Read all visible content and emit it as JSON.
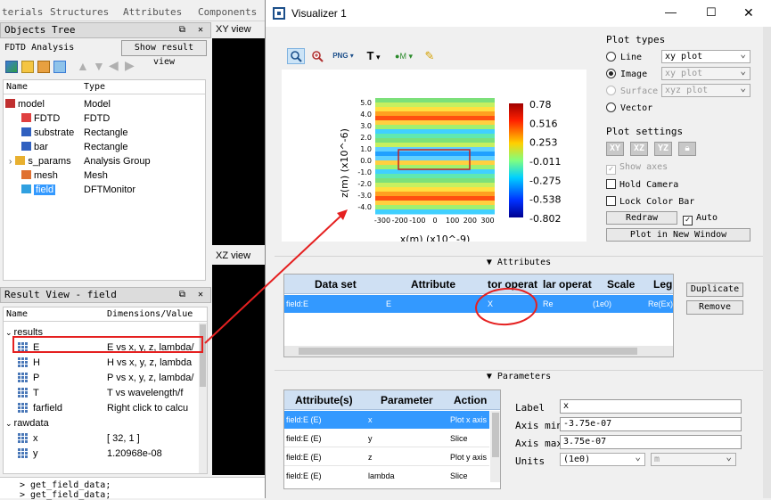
{
  "top_menu": [
    "terials",
    "Structures",
    "Attributes",
    "Components"
  ],
  "objects_tree": {
    "title": "Objects Tree",
    "window_controls": "⧉ ✕",
    "analysis_label": "FDTD Analysis",
    "show_result_button": "Show result view",
    "columns": [
      "Name",
      "Type"
    ],
    "rows": [
      {
        "name": "model",
        "type": "Model",
        "icon": "model-icon"
      },
      {
        "name": "FDTD",
        "type": "FDTD",
        "icon": "fdtd-icon"
      },
      {
        "name": "substrate",
        "type": "Rectangle",
        "icon": "rectangle-icon"
      },
      {
        "name": "bar",
        "type": "Rectangle",
        "icon": "rectangle-icon"
      },
      {
        "name": "s_params",
        "type": "Analysis Group",
        "icon": "folder-icon"
      },
      {
        "name": "mesh",
        "type": "Mesh",
        "icon": "mesh-icon"
      },
      {
        "name": "field",
        "type": "DFTMonitor",
        "icon": "monitor-icon"
      }
    ]
  },
  "view_labels": {
    "xy": "XY view",
    "xz": "XZ view"
  },
  "result_view": {
    "title": "Result View - field",
    "window_controls": "⧉ ✕",
    "columns": [
      "Name",
      "Dimensions/Value"
    ],
    "groups": [
      {
        "label": "results",
        "items": [
          {
            "name": "E",
            "value": "E vs x, y, z, lambda/"
          },
          {
            "name": "H",
            "value": "H vs x, y, z, lambda"
          },
          {
            "name": "P",
            "value": "P vs x, y, z, lambda/"
          },
          {
            "name": "T",
            "value": "T vs wavelength/f"
          },
          {
            "name": "farfield",
            "value": "Right click to calcu"
          }
        ]
      },
      {
        "label": "rawdata",
        "items": [
          {
            "name": "x",
            "value": "[ 32, 1 ]"
          },
          {
            "name": "y",
            "value": "1.20968e-08"
          }
        ]
      }
    ]
  },
  "console": [
    "> get_field_data;",
    "> get_field_data;"
  ],
  "visualizer": {
    "title": "Visualizer 1",
    "window_buttons": [
      "—",
      "☐",
      "✕"
    ],
    "toolbar": [
      "zoom-icon",
      "zoom-in-icon",
      "png-export-icon",
      "text-icon",
      "marker-icon",
      "pen-icon"
    ],
    "toolbar_labels": {
      "png": "PNG",
      "text": "T",
      "marker": "M"
    },
    "plot": {
      "ylabel": "z(m) (x10^-6)",
      "xlabel": "x(m) (x10^-9)",
      "yticks": [
        "5.0",
        "4.0",
        "3.0",
        "2.0",
        "1.0",
        "0.0",
        "-1.0",
        "-2.0",
        "-3.0",
        "-4.0"
      ],
      "xticks": [
        "-300",
        "-200",
        "-100",
        "0",
        "100",
        "200",
        "300"
      ],
      "colorbar_ticks": [
        "0.78",
        "0.516",
        "0.253",
        "-0.011",
        "-0.275",
        "-0.538",
        "-0.802"
      ]
    },
    "plot_types": {
      "title": "Plot types",
      "options": [
        {
          "label": "Line",
          "select": "xy plot",
          "on": false,
          "disabled": false
        },
        {
          "label": "Image",
          "select": "xy plot",
          "on": true,
          "disabled": false
        },
        {
          "label": "Surface",
          "select": "xyz plot",
          "on": false,
          "disabled": true
        },
        {
          "label": "Vector",
          "select": "",
          "on": false,
          "disabled": false
        }
      ]
    },
    "plot_settings": {
      "title": "Plot settings",
      "view_buttons": [
        "XY",
        "XZ",
        "YZ"
      ],
      "show_axes": "Show axes",
      "hold_camera": "Hold Camera",
      "lock_color_bar": "Lock Color Bar",
      "redraw": "Redraw",
      "auto": "Auto",
      "new_window": "Plot in New Window"
    },
    "attributes": {
      "section": "Attributes",
      "columns": [
        "Data set",
        "Attribute",
        "tor operat",
        "lar operat",
        "Scale",
        "Leg"
      ],
      "row": [
        "field:E",
        "E",
        "X",
        "Re",
        "(1e0)",
        "Re(Ex)"
      ],
      "duplicate": "Duplicate",
      "remove": "Remove"
    },
    "parameters": {
      "section": "Parameters",
      "columns": [
        "Attribute(s)",
        "Parameter",
        "Action"
      ],
      "rows": [
        [
          "field:E (E)",
          "x",
          "Plot x axis"
        ],
        [
          "field:E (E)",
          "y",
          "Slice"
        ],
        [
          "field:E (E)",
          "z",
          "Plot y axis"
        ],
        [
          "field:E (E)",
          "lambda",
          "Slice"
        ]
      ],
      "label_label": "Label",
      "label_value": "x",
      "axis_min_label": "Axis min",
      "axis_min": "-3.75e-07",
      "axis_max_label": "Axis max",
      "axis_max": "3.75e-07",
      "units_label": "Units",
      "units": "(1e0)",
      "units2": "m"
    }
  },
  "colors": {
    "accent": "#3399ff",
    "annotation": "#e52020"
  }
}
